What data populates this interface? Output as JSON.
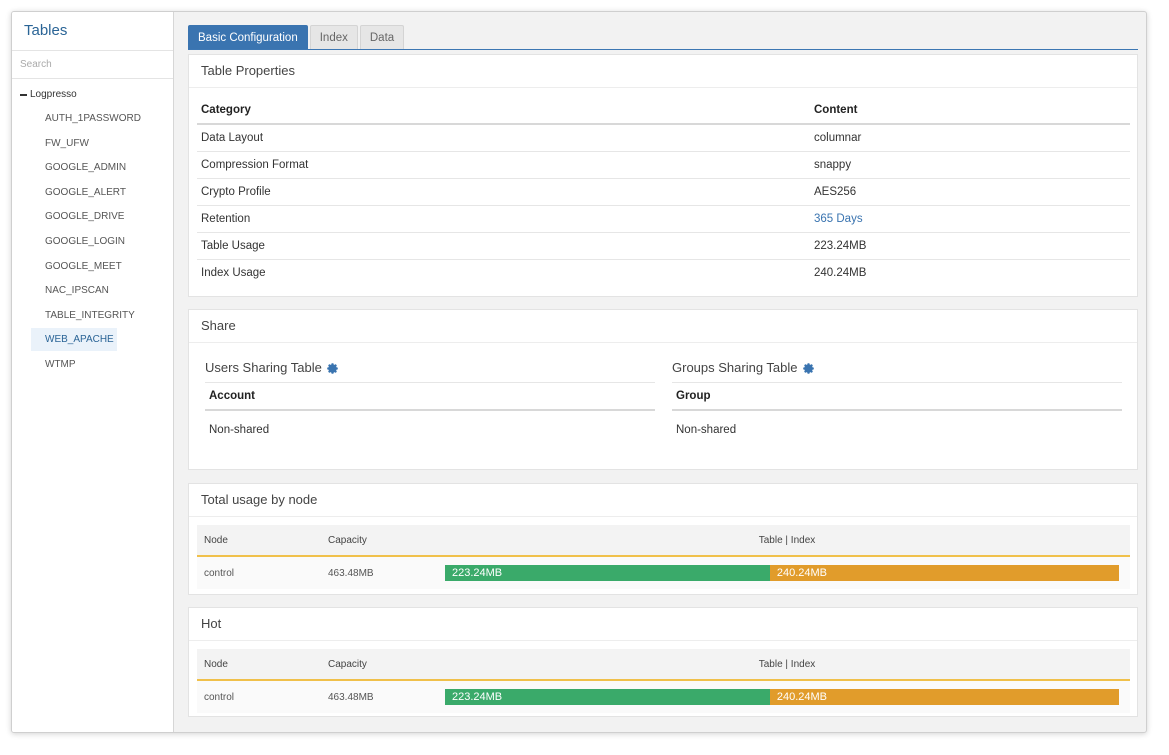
{
  "sidebar": {
    "title": "Tables",
    "search_placeholder": "Search",
    "root_label": "Logpresso",
    "items": [
      {
        "label": "AUTH_1PASSWORD"
      },
      {
        "label": "FW_UFW"
      },
      {
        "label": "GOOGLE_ADMIN"
      },
      {
        "label": "GOOGLE_ALERT"
      },
      {
        "label": "GOOGLE_DRIVE"
      },
      {
        "label": "GOOGLE_LOGIN"
      },
      {
        "label": "GOOGLE_MEET"
      },
      {
        "label": "NAC_IPSCAN"
      },
      {
        "label": "TABLE_INTEGRITY"
      },
      {
        "label": "WEB_APACHE",
        "selected": true
      },
      {
        "label": "WTMP"
      }
    ]
  },
  "tabs": [
    {
      "label": "Basic Configuration",
      "active": true
    },
    {
      "label": "Index"
    },
    {
      "label": "Data"
    }
  ],
  "properties": {
    "title": "Table Properties",
    "headers": {
      "category": "Category",
      "content": "Content"
    },
    "rows": [
      {
        "category": "Data Layout",
        "content": "columnar"
      },
      {
        "category": "Compression Format",
        "content": "snappy"
      },
      {
        "category": "Crypto Profile",
        "content": "AES256"
      },
      {
        "category": "Retention",
        "content": "365 Days"
      },
      {
        "category": "Table Usage",
        "content": "223.24MB"
      },
      {
        "category": "Index Usage",
        "content": "240.24MB"
      }
    ]
  },
  "share": {
    "title": "Share",
    "users": {
      "heading": "Users Sharing Table",
      "column": "Account",
      "value": "Non-shared"
    },
    "groups": {
      "heading": "Groups Sharing Table",
      "column": "Group",
      "value": "Non-shared"
    }
  },
  "total_usage": {
    "title": "Total usage by node",
    "headers": {
      "node": "Node",
      "capacity": "Capacity",
      "split": "Table | Index"
    },
    "row": {
      "node": "control",
      "capacity": "463.48MB",
      "table": "223.24MB",
      "index": "240.24MB",
      "table_fraction": 0.482
    }
  },
  "hot": {
    "title": "Hot",
    "headers": {
      "node": "Node",
      "capacity": "Capacity",
      "split": "Table | Index"
    },
    "row": {
      "node": "control",
      "capacity": "463.48MB",
      "table": "223.24MB",
      "index": "240.24MB",
      "table_fraction": 0.482
    }
  },
  "colors": {
    "accent": "#3a74b0",
    "table_bar": "#3aaa6a",
    "index_bar": "#e19c2b",
    "header_rule": "#f0c04a"
  }
}
